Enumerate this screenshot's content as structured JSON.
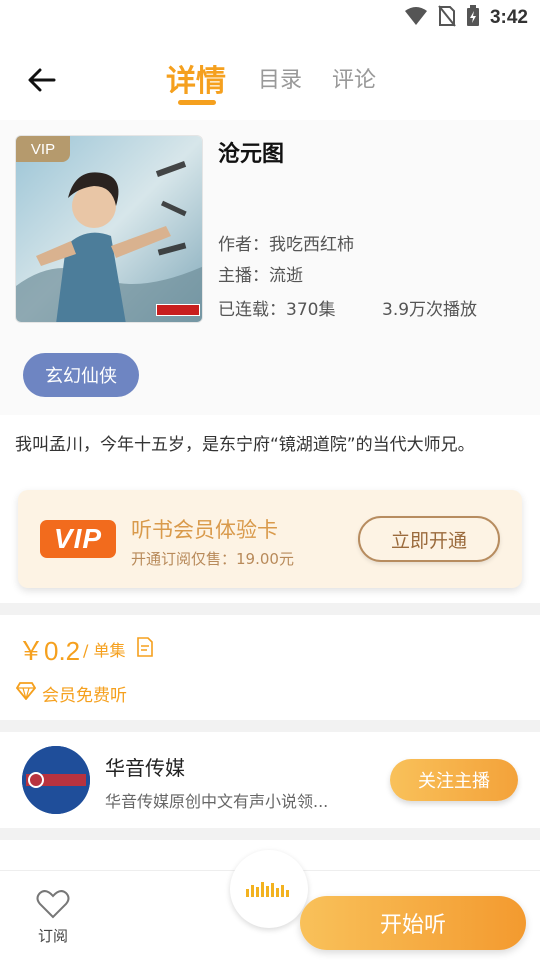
{
  "status_bar": {
    "time": "3:42"
  },
  "header": {
    "tabs": [
      {
        "label": "详情",
        "active": true
      },
      {
        "label": "目录",
        "active": false
      },
      {
        "label": "评论",
        "active": false
      }
    ]
  },
  "book": {
    "vip_badge": "VIP",
    "title": "沧元图",
    "author": "作者：我吃西红柿",
    "narrator": "主播：流逝",
    "serial": "已连载：370集",
    "plays": "3.9万次播放",
    "genre": "玄幻仙侠",
    "intro": "我叫孟川，今年十五岁，是东宁府“镜湖道院”的当代大师兄。"
  },
  "vip_card": {
    "logo": "VIP",
    "title": "听书会员体验卡",
    "subtitle": "开通订阅仅售：19.00元",
    "button": "立即开通"
  },
  "price": {
    "amount": "￥0.2",
    "unit": "/ 单集",
    "member_free": "会员免费听"
  },
  "publisher": {
    "name": "华音传媒",
    "description": "华音传媒原创中文有声小说领...",
    "follow": "关注主播"
  },
  "bottom": {
    "subscribe": "订阅",
    "start": "开始听"
  },
  "colors": {
    "accent": "#f5a01e",
    "genre_tag": "#6e85c2",
    "vip_logo": "#f26b1d"
  }
}
